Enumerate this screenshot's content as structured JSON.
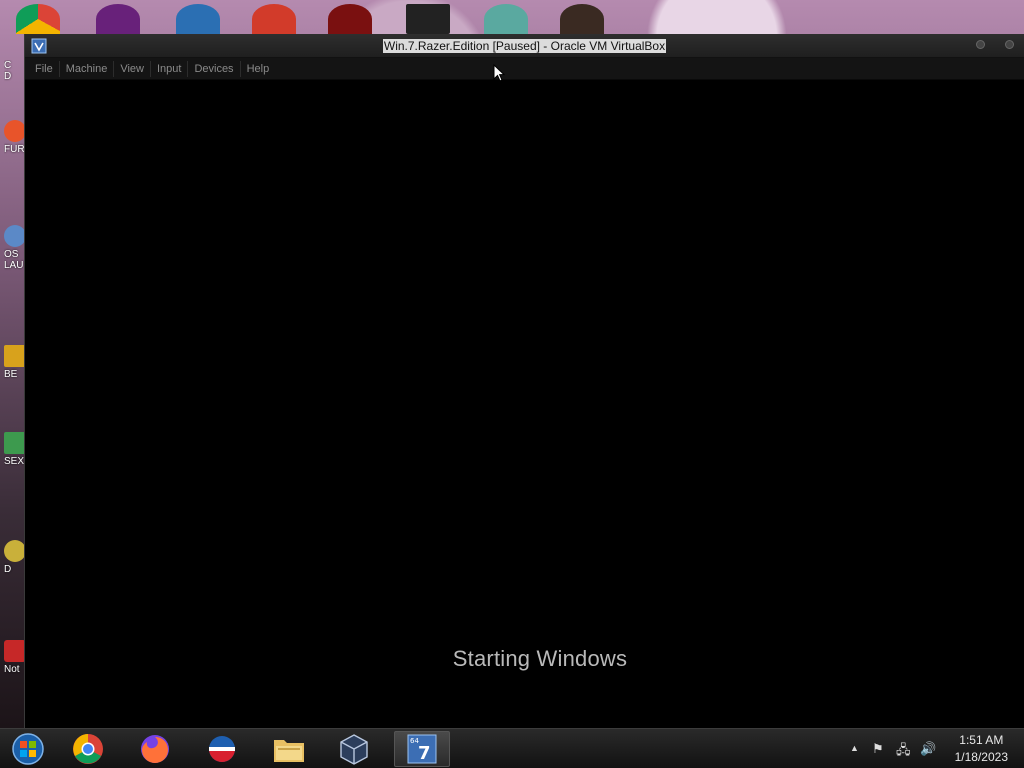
{
  "window": {
    "title": "Win.7.Razer.Edition [Paused] - Oracle VM VirtualBox"
  },
  "menubar": {
    "items": [
      {
        "label": "File"
      },
      {
        "label": "Machine"
      },
      {
        "label": "View"
      },
      {
        "label": "Input"
      },
      {
        "label": "Devices"
      },
      {
        "label": "Help"
      }
    ]
  },
  "vm_screen": {
    "boot_message": "Starting Windows"
  },
  "desktop": {
    "icons": [
      {
        "label": "C\nD",
        "icon": "chrome-icon"
      },
      {
        "label": "FUR",
        "icon": "app-icon"
      },
      {
        "label": "OS\nLAU",
        "icon": "app-icon"
      },
      {
        "label": "BE",
        "icon": "app-icon"
      },
      {
        "label": "SEX",
        "icon": "app-icon"
      },
      {
        "label": "D",
        "icon": "app-icon"
      },
      {
        "label": "Not",
        "icon": "app-icon"
      }
    ]
  },
  "taskbar": {
    "apps": [
      {
        "name": "start-button",
        "icon": "windows-orb-icon"
      },
      {
        "name": "chrome",
        "icon": "chrome-icon"
      },
      {
        "name": "firefox",
        "icon": "firefox-icon"
      },
      {
        "name": "browser",
        "icon": "globe-icon"
      },
      {
        "name": "file-explorer",
        "icon": "folder-icon"
      },
      {
        "name": "virtualbox",
        "icon": "virtualbox-icon"
      },
      {
        "name": "vm-window",
        "icon": "win7-vm-icon",
        "badge": "64",
        "active": true
      }
    ],
    "tray": {
      "time": "1:51 AM",
      "date": "1/18/2023"
    }
  },
  "colors": {
    "title_bar": "#1f1f1f",
    "menu_text": "#8a8a8a",
    "boot_text": "#b9b9b9"
  }
}
